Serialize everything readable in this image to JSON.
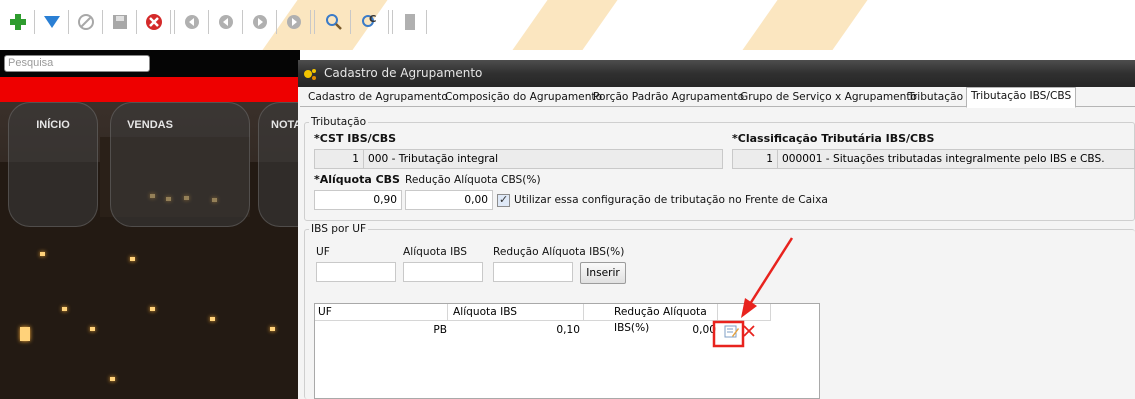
{
  "toolbar": {
    "buttons": [
      {
        "name": "add-icon"
      },
      {
        "name": "filter-icon"
      },
      {
        "name": "cancel-icon"
      },
      {
        "name": "save-icon"
      },
      {
        "name": "delete-icon"
      },
      {
        "name": "first-record-icon"
      },
      {
        "name": "previous-record-icon"
      },
      {
        "name": "next-record-icon"
      },
      {
        "name": "last-record-icon"
      },
      {
        "name": "search-icon"
      },
      {
        "name": "search-code-icon"
      },
      {
        "name": "report-icon"
      }
    ]
  },
  "background_app": {
    "search_placeholder": "Pesquisa",
    "nav": [
      "INÍCIO",
      "VENDAS",
      "NOTA"
    ]
  },
  "window": {
    "title": "Cadastro de Agrupamento",
    "tabs": [
      "Cadastro de Agrupamento",
      "Composição do Agrupamento",
      "Porção Padrão Agrupamento",
      "Grupo de Serviço x Agrupamento",
      "Tributação",
      "Tributação IBS/CBS"
    ],
    "active_tab": 5,
    "tributacao": {
      "legend": "Tributação",
      "cst_label": "*CST IBS/CBS",
      "cst_code": "1",
      "cst_desc": "000 - Tributação integral",
      "class_label": "*Classificação Tributária IBS/CBS",
      "class_code": "1",
      "class_desc": "000001 - Situações tributadas integralmente pelo IBS e CBS.",
      "aliq_cbs_label": "*Alíquota CBS",
      "aliq_cbs_value": "0,90",
      "red_cbs_label": "Redução Alíquota CBS(%)",
      "red_cbs_value": "0,00",
      "checkbox_label": "Utilizar essa configuração de tributação no Frente de Caixa",
      "checkbox_checked": true
    },
    "ibs_uf": {
      "legend": "IBS por UF",
      "uf_label": "UF",
      "aliq_label": "Alíquota IBS",
      "red_label": "Redução Alíquota IBS(%)",
      "insert_button": "Inserir",
      "grid_headers": [
        "UF",
        "Alíquota IBS",
        "Redução Alíquota IBS(%)"
      ],
      "rows": [
        {
          "uf": "PB",
          "aliq": "0,10",
          "red": "0,00"
        }
      ]
    }
  },
  "colors": {
    "annotation": "#e8231e",
    "red_bar": "#ee0000",
    "title_bar": "#303030"
  }
}
